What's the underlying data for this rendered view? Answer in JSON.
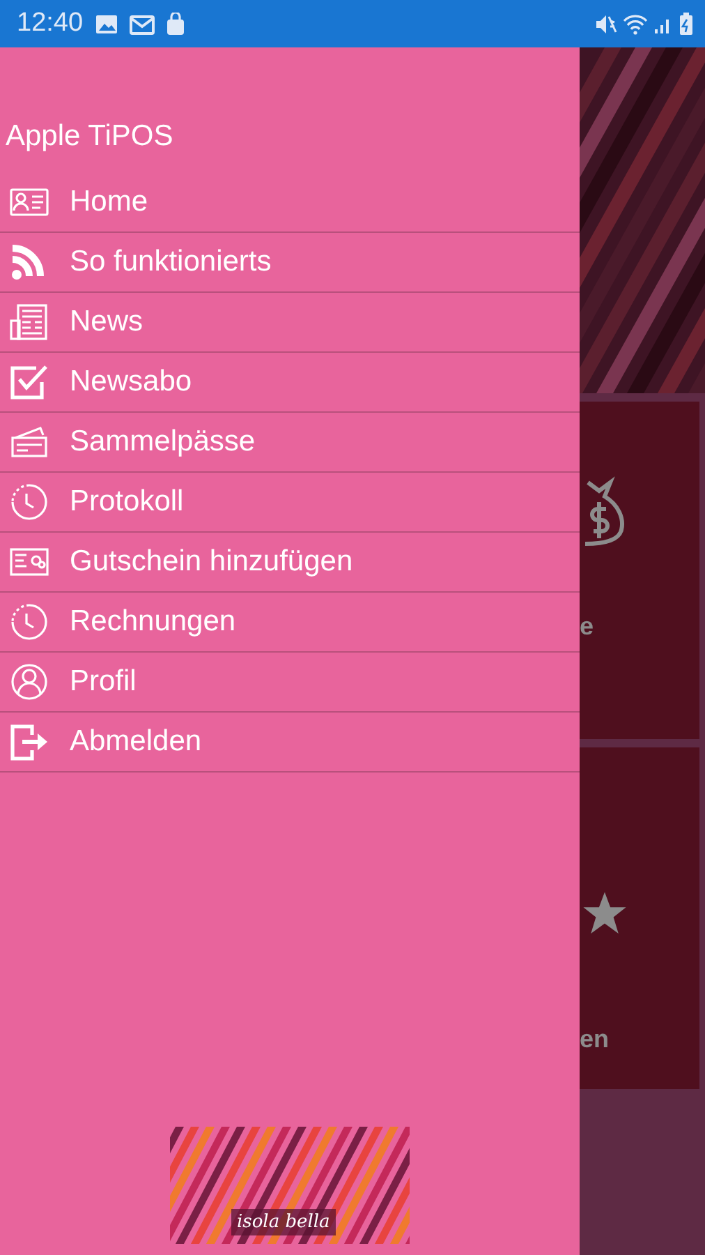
{
  "status_bar": {
    "time": "12:40"
  },
  "drawer": {
    "title": "Apple TiPOS",
    "items": [
      {
        "label": "Home",
        "kind": "card"
      },
      {
        "label": "So funktionierts",
        "kind": "feed"
      },
      {
        "label": "News",
        "kind": "news"
      },
      {
        "label": "Newsabo",
        "kind": "check"
      },
      {
        "label": "Sammelpässe",
        "kind": "tickets"
      },
      {
        "label": "Protokoll",
        "kind": "history"
      },
      {
        "label": "Gutschein hinzufügen",
        "kind": "voucher"
      },
      {
        "label": "Rechnungen",
        "kind": "history"
      },
      {
        "label": "Profil",
        "kind": "profile"
      },
      {
        "label": "Abmelden",
        "kind": "exit"
      }
    ],
    "logo": {
      "text": "isola bella"
    }
  },
  "background": {
    "cards": [
      {
        "label": "e",
        "kind": "money"
      },
      {
        "label": "en",
        "kind": "rating"
      }
    ]
  }
}
